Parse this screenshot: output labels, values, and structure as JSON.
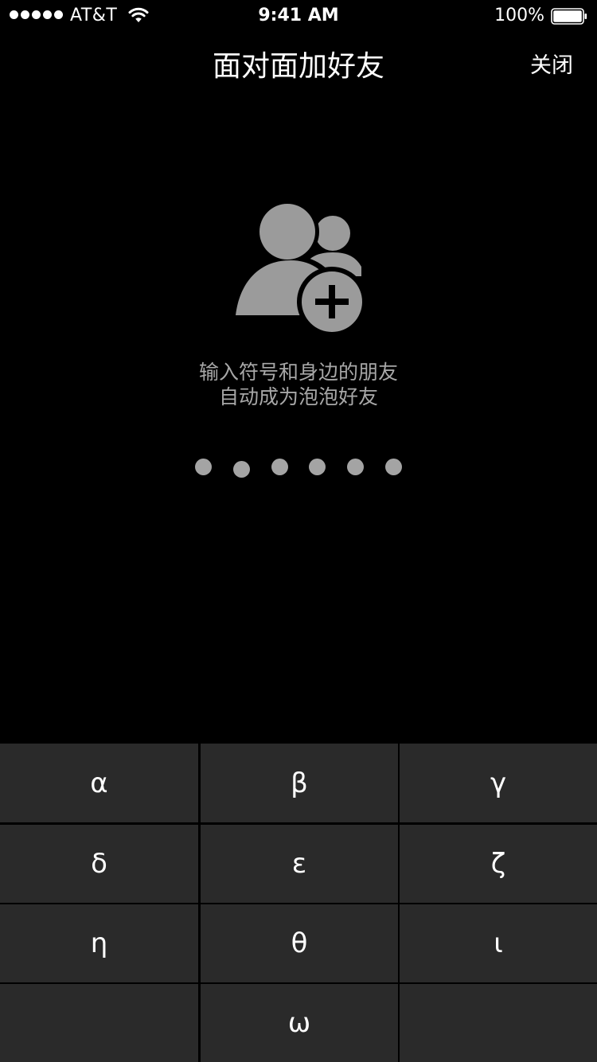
{
  "status_bar": {
    "carrier": "AT&T",
    "time": "9:41 AM",
    "battery_percent": "100%",
    "signal_bars": 5,
    "battery_level": 1.0,
    "icons": [
      "signal-dots-icon",
      "wifi-icon",
      "battery-icon"
    ]
  },
  "nav": {
    "title": "面对面加好友",
    "close_label": "关闭"
  },
  "illustration": {
    "icon": "add-friends-icon",
    "color": "#9b9b9b"
  },
  "hint": {
    "line1": "输入符号和身边的朋友",
    "line2": "自动成为泡泡好友"
  },
  "code": {
    "length": 6,
    "entered": 0,
    "dot_color": "#a4a4a4"
  },
  "keypad": {
    "key_background": "#2a2a2a",
    "keys": [
      "α",
      "β",
      "γ",
      "δ",
      "ε",
      "ζ",
      "η",
      "θ",
      "ι",
      "",
      "ω",
      ""
    ]
  }
}
